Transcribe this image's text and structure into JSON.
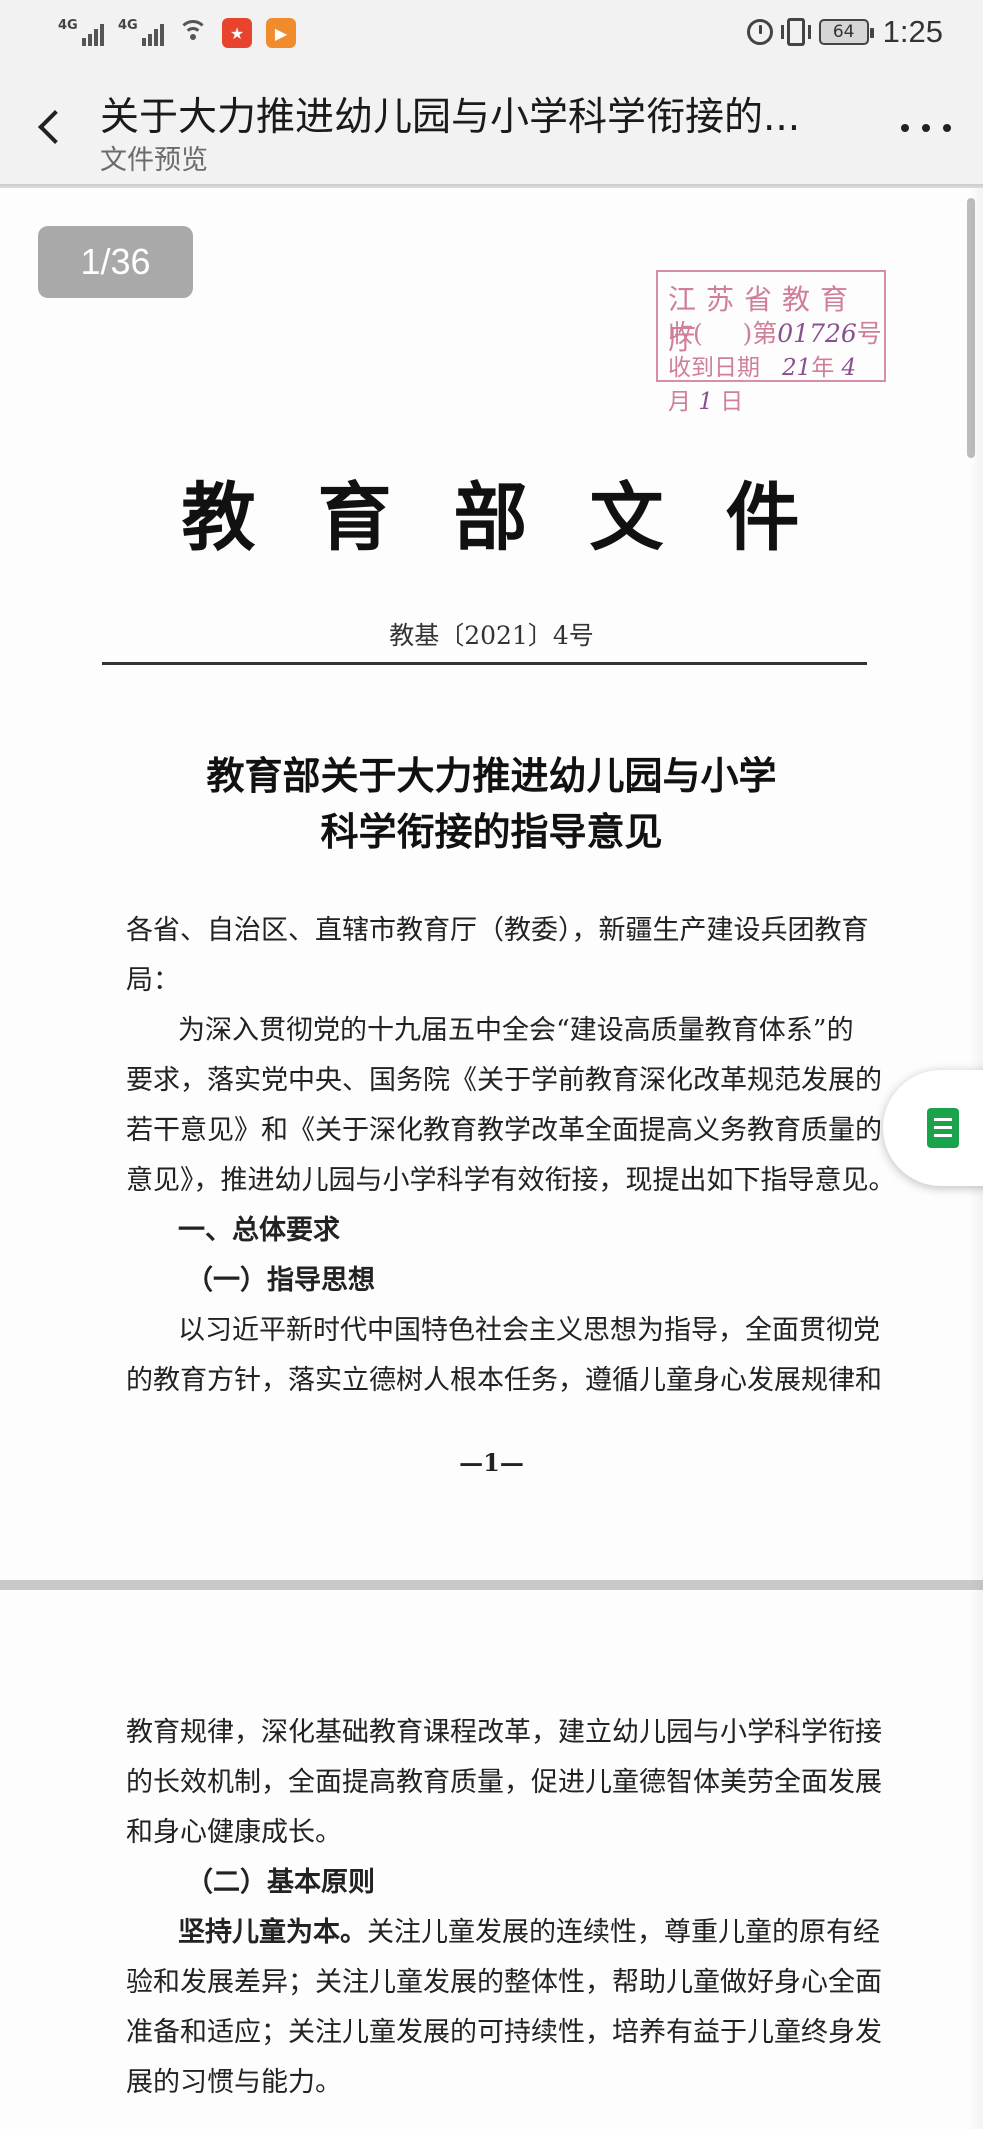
{
  "status_bar": {
    "network_tag_1": "4G",
    "network_tag_2": "4G",
    "battery": "64",
    "time": "1:25",
    "app_icon_1_color": "#e8432d",
    "app_icon_2_color": "#f08c2b"
  },
  "header": {
    "title": "关于大力推进幼儿园与小学科学衔接的...",
    "subtitle": "文件预览",
    "back_icon": "chevron-left-icon",
    "more_icon": "more-dots-icon"
  },
  "viewer": {
    "page_indicator": "1/36",
    "float_icon": "spreadsheet-icon",
    "float_color": "#1aa34a"
  },
  "page1": {
    "stamp": {
      "line1": "江苏省教育厅",
      "line2_prefix": "收(",
      "line2_mid": ")第",
      "line2_handwritten": "01726",
      "line2_suffix": "号",
      "line3_prefix": "收到日期",
      "line3_handwritten_year": "21",
      "line3_year_label": "年",
      "line3_handwritten_month": "4",
      "line3_month_label": "月",
      "line3_handwritten_day": "1",
      "line3_day_label": "日"
    },
    "doc_header": "教育部文件",
    "doc_number": "教基〔2021〕4号",
    "doc_title_line1": "教育部关于大力推进幼儿园与小学",
    "doc_title_line2": "科学衔接的指导意见",
    "lines": [
      "各省、自治区、直辖市教育厅（教委），新疆生产建设兵团教育",
      "局：",
      "为深入贯彻党的十九届五中全会“建设高质量教育体系”的",
      "要求，落实党中央、国务院《关于学前教育深化改革规范发展的",
      "若干意见》和《关于深化教育教学改革全面提高义务教育质量的",
      "意见》，推进幼儿园与小学科学有效衔接，现提出如下指导意见。",
      "一、总体要求",
      "（一）指导思想",
      "以习近平新时代中国特色社会主义思想为指导，全面贯彻党",
      "的教育方针，落实立德树人根本任务，遵循儿童身心发展规律和"
    ],
    "footer_page": "—1—"
  },
  "page2": {
    "lines": [
      "教育规律，深化基础教育课程改革，建立幼儿园与小学科学衔接",
      "的长效机制，全面提高教育质量，促进儿童德智体美劳全面发展",
      "和身心健康成长。",
      "（二）基本原则",
      "坚持儿童为本。",
      "关注儿童发展的连续性，尊重儿童的原有经",
      "验和发展差异；关注儿童发展的整体性，帮助儿童做好身心全面",
      "准备和适应；关注儿童发展的可持续性，培养有益于儿童终身发",
      "展的习惯与能力。"
    ]
  }
}
